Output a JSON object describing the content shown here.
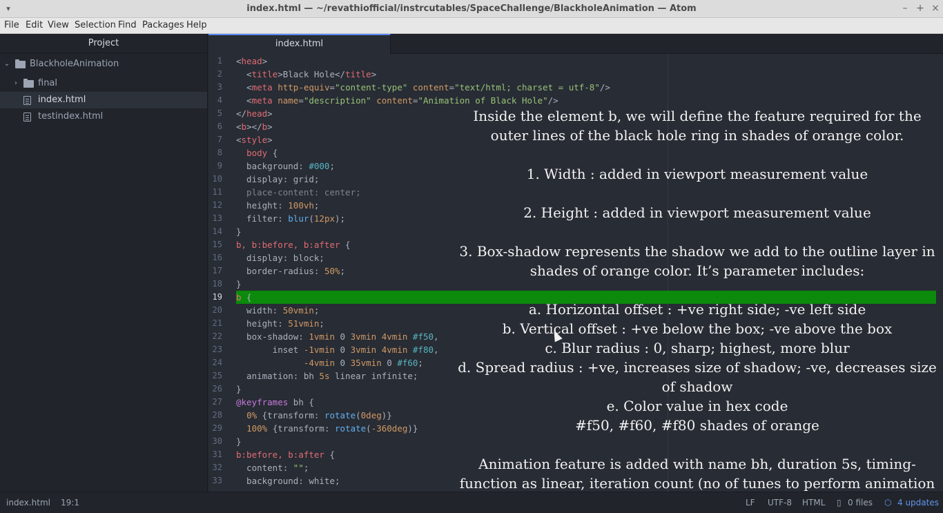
{
  "window": {
    "title": "index.html — ~/revathiofficial/instrcutables/SpaceChallenge/BlackholeAnimation — Atom"
  },
  "menu": [
    "File",
    "Edit",
    "View",
    "Selection",
    "Find",
    "Packages",
    "Help"
  ],
  "tree": {
    "header": "Project",
    "root": "BlackholeAnimation",
    "items": [
      {
        "type": "folder",
        "label": "final"
      },
      {
        "type": "file",
        "label": "index.html"
      },
      {
        "type": "file",
        "label": "testindex.html"
      }
    ]
  },
  "tab": {
    "label": "index.html"
  },
  "code": {
    "lines": [
      "<head>",
      "  <title>Black Hole</title>",
      "  <meta http-equiv=\"content-type\" content=\"text/html; charset = utf-8\"/>",
      "  <meta name=\"description\" content=\"Animation of Black Hole\"/>",
      "</head>",
      "<b></b>",
      "<style>",
      "  body {",
      "  background: #000;",
      "  display: grid;",
      "  place-content: center;",
      "  height: 100vh;",
      "  filter: blur(12px);",
      "}",
      "b, b:before, b:after {",
      "  display: block;",
      "  border-radius: 50%;",
      "}",
      "b {",
      "  width: 50vmin;",
      "  height: 51vmin;",
      "  box-shadow: 1vmin 0 3vmin 4vmin #f50,",
      "       inset -1vmin 0 3vmin 4vmin #f80,",
      "             -4vmin 0 35vmin 0 #f60;",
      "  animation: bh 5s linear infinite;",
      "}",
      "@keyframes bh {",
      "  0% {transform: rotate(0deg)}",
      "  100% {transform: rotate(-360deg)}",
      "}",
      "b:before, b:after {",
      "  content: \"\";",
      "  background: white;"
    ],
    "current_line": 19
  },
  "annotation": {
    "intro": "Inside the element b, we will define the feature required for the outer lines of the black hole ring in shades of orange color.",
    "p1": "1. Width : added in viewport measurement value",
    "p2": "2. Height : added in viewport measurement value",
    "p3": "3. Box-shadow represents the shadow we add to the outline layer in shades of orange color. It’s parameter includes:",
    "a": "a. Horizontal offset : +ve right side; -ve left side",
    "b": "b. Vertical offset : +ve below the box; -ve above the box",
    "c": "c. Blur radius : 0, sharp; highest, more blur",
    "d": "d. Spread radius : +ve, increases size of shadow; -ve, decreases size of shadow",
    "e": "e. Color value in hex code",
    "e2": "#f50, #f60, #f80 shades of orange",
    "anim": "Animation feature is added with name bh, duration 5s, timing-function as linear, iteration count (no of tunes to perform animation as infinite"
  },
  "status": {
    "file": "index.html",
    "cursor": "19:1",
    "line_ending": "LF",
    "encoding": "UTF-8",
    "grammar": "HTML",
    "files": "0 files",
    "updates": "4 updates"
  }
}
